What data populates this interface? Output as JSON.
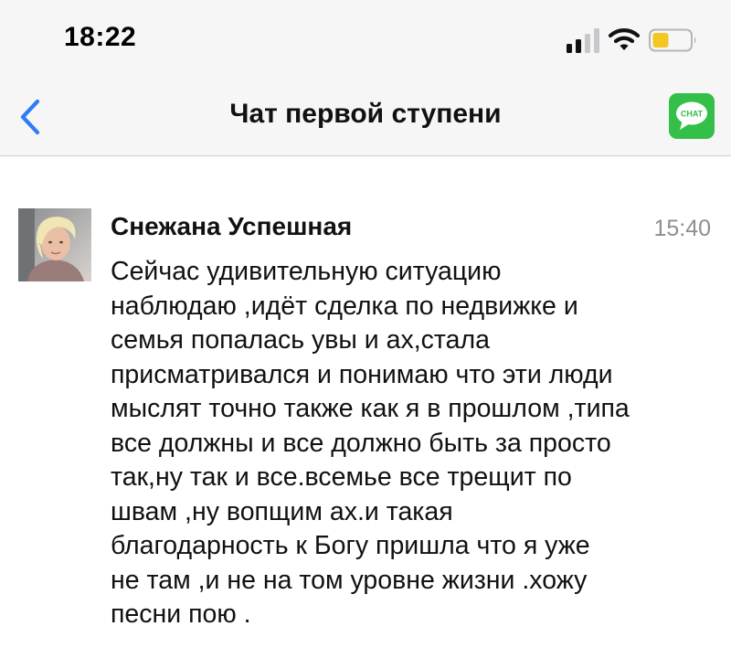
{
  "status_bar": {
    "time": "18:22",
    "icons": [
      "signal-icon",
      "wifi-icon",
      "battery-icon"
    ],
    "battery_color": "#f3c623"
  },
  "nav": {
    "back_icon": "chevron-left-icon",
    "title": "Чат первой ступени",
    "chat_icon_label": "CHAT",
    "accent_color": "#2f7cf6",
    "chat_button_color": "#34c048"
  },
  "message": {
    "sender": "Снежана Успешная",
    "time": "15:40",
    "text": "Сейчас удивительную ситуацию\nнаблюдаю ,идёт сделка по недвижке и\nсемья попалась увы и ах,стала\nприсматривался и понимаю что эти люди\nмыслят точно также как я в прошлом ,типа\nвсе должны и все должно быть за просто\nтак,ну так и все.всемье все трещит  по\nшвам ,ну вопщим ах.и такая\nблагодарность к Богу пришла что я  уже\nне там ,и не на том уровне жизни .хожу\nпесни пою ."
  }
}
